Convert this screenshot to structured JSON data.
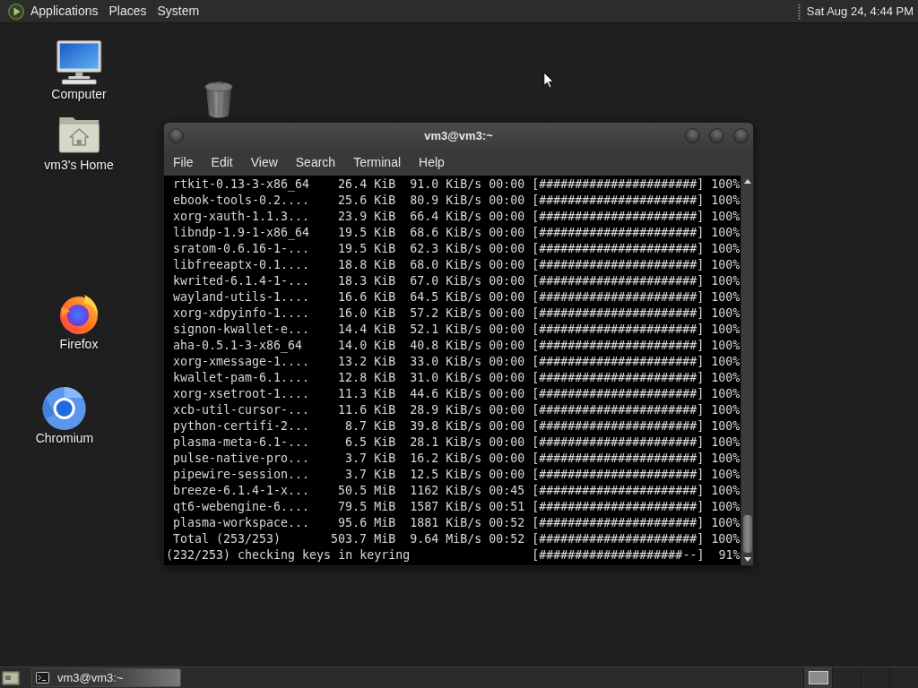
{
  "top_panel": {
    "menus": [
      "Applications",
      "Places",
      "System"
    ],
    "clock": "Sat Aug 24, 4:44 PM"
  },
  "desktop_icons": [
    {
      "kind": "computer",
      "label": "Computer"
    },
    {
      "kind": "trash"
    },
    {
      "kind": "home",
      "label": "vm3's Home"
    },
    {
      "kind": "firefox",
      "label": "Firefox"
    },
    {
      "kind": "chromium",
      "label": "Chromium"
    }
  ],
  "terminal_window": {
    "title": "vm3@vm3:~",
    "menus": [
      "File",
      "Edit",
      "View",
      "Search",
      "Terminal",
      "Help"
    ],
    "rows": [
      {
        "name": "rtkit-0.13-3-x86_64",
        "size": "26.4 KiB",
        "rate": "91.0 KiB/s",
        "time": "00:00",
        "bar": "[######################]",
        "percent": "100%"
      },
      {
        "name": "ebook-tools-0.2....",
        "size": "25.6 KiB",
        "rate": "80.9 KiB/s",
        "time": "00:00",
        "bar": "[######################]",
        "percent": "100%"
      },
      {
        "name": "xorg-xauth-1.1.3...",
        "size": "23.9 KiB",
        "rate": "66.4 KiB/s",
        "time": "00:00",
        "bar": "[######################]",
        "percent": "100%"
      },
      {
        "name": "libndp-1.9-1-x86_64",
        "size": "19.5 KiB",
        "rate": "68.6 KiB/s",
        "time": "00:00",
        "bar": "[######################]",
        "percent": "100%"
      },
      {
        "name": "sratom-0.6.16-1-...",
        "size": "19.5 KiB",
        "rate": "62.3 KiB/s",
        "time": "00:00",
        "bar": "[######################]",
        "percent": "100%"
      },
      {
        "name": "libfreeaptx-0.1....",
        "size": "18.8 KiB",
        "rate": "68.0 KiB/s",
        "time": "00:00",
        "bar": "[######################]",
        "percent": "100%"
      },
      {
        "name": "kwrited-6.1.4-1-...",
        "size": "18.3 KiB",
        "rate": "67.0 KiB/s",
        "time": "00:00",
        "bar": "[######################]",
        "percent": "100%"
      },
      {
        "name": "wayland-utils-1....",
        "size": "16.6 KiB",
        "rate": "64.5 KiB/s",
        "time": "00:00",
        "bar": "[######################]",
        "percent": "100%"
      },
      {
        "name": "xorg-xdpyinfo-1....",
        "size": "16.0 KiB",
        "rate": "57.2 KiB/s",
        "time": "00:00",
        "bar": "[######################]",
        "percent": "100%"
      },
      {
        "name": "signon-kwallet-e...",
        "size": "14.4 KiB",
        "rate": "52.1 KiB/s",
        "time": "00:00",
        "bar": "[######################]",
        "percent": "100%"
      },
      {
        "name": "aha-0.5.1-3-x86_64",
        "size": "14.0 KiB",
        "rate": "40.8 KiB/s",
        "time": "00:00",
        "bar": "[######################]",
        "percent": "100%"
      },
      {
        "name": "xorg-xmessage-1....",
        "size": "13.2 KiB",
        "rate": "33.0 KiB/s",
        "time": "00:00",
        "bar": "[######################]",
        "percent": "100%"
      },
      {
        "name": "kwallet-pam-6.1....",
        "size": "12.8 KiB",
        "rate": "31.0 KiB/s",
        "time": "00:00",
        "bar": "[######################]",
        "percent": "100%"
      },
      {
        "name": "xorg-xsetroot-1....",
        "size": "11.3 KiB",
        "rate": "44.6 KiB/s",
        "time": "00:00",
        "bar": "[######################]",
        "percent": "100%"
      },
      {
        "name": "xcb-util-cursor-...",
        "size": "11.6 KiB",
        "rate": "28.9 KiB/s",
        "time": "00:00",
        "bar": "[######################]",
        "percent": "100%"
      },
      {
        "name": "python-certifi-2...",
        "size": "8.7 KiB",
        "rate": "39.8 KiB/s",
        "time": "00:00",
        "bar": "[######################]",
        "percent": "100%"
      },
      {
        "name": "plasma-meta-6.1-...",
        "size": "6.5 KiB",
        "rate": "28.1 KiB/s",
        "time": "00:00",
        "bar": "[######################]",
        "percent": "100%"
      },
      {
        "name": "pulse-native-pro...",
        "size": "3.7 KiB",
        "rate": "16.2 KiB/s",
        "time": "00:00",
        "bar": "[######################]",
        "percent": "100%"
      },
      {
        "name": "pipewire-session...",
        "size": "3.7 KiB",
        "rate": "12.5 KiB/s",
        "time": "00:00",
        "bar": "[######################]",
        "percent": "100%"
      },
      {
        "name": "breeze-6.1.4-1-x...",
        "size": "50.5 MiB",
        "rate": "1162 KiB/s",
        "time": "00:45",
        "bar": "[######################]",
        "percent": "100%"
      },
      {
        "name": "qt6-webengine-6....",
        "size": "79.5 MiB",
        "rate": "1587 KiB/s",
        "time": "00:51",
        "bar": "[######################]",
        "percent": "100%"
      },
      {
        "name": "plasma-workspace...",
        "size": "95.6 MiB",
        "rate": "1881 KiB/s",
        "time": "00:52",
        "bar": "[######################]",
        "percent": "100%"
      },
      {
        "name": "Total (253/253)",
        "size": "503.7 MiB",
        "rate": "9.64 MiB/s",
        "time": "00:52",
        "bar": "[######################]",
        "percent": "100%"
      }
    ],
    "status_line": {
      "text": "(232/253) checking keys in keyring",
      "bar": "[####################--]",
      "percent": "91%"
    }
  },
  "bottom_panel": {
    "tasks": [
      {
        "label": "vm3@vm3:~"
      }
    ],
    "workspaces": [
      {
        "selected": true
      },
      {
        "selected": false
      },
      {
        "selected": false
      },
      {
        "selected": false
      }
    ]
  }
}
